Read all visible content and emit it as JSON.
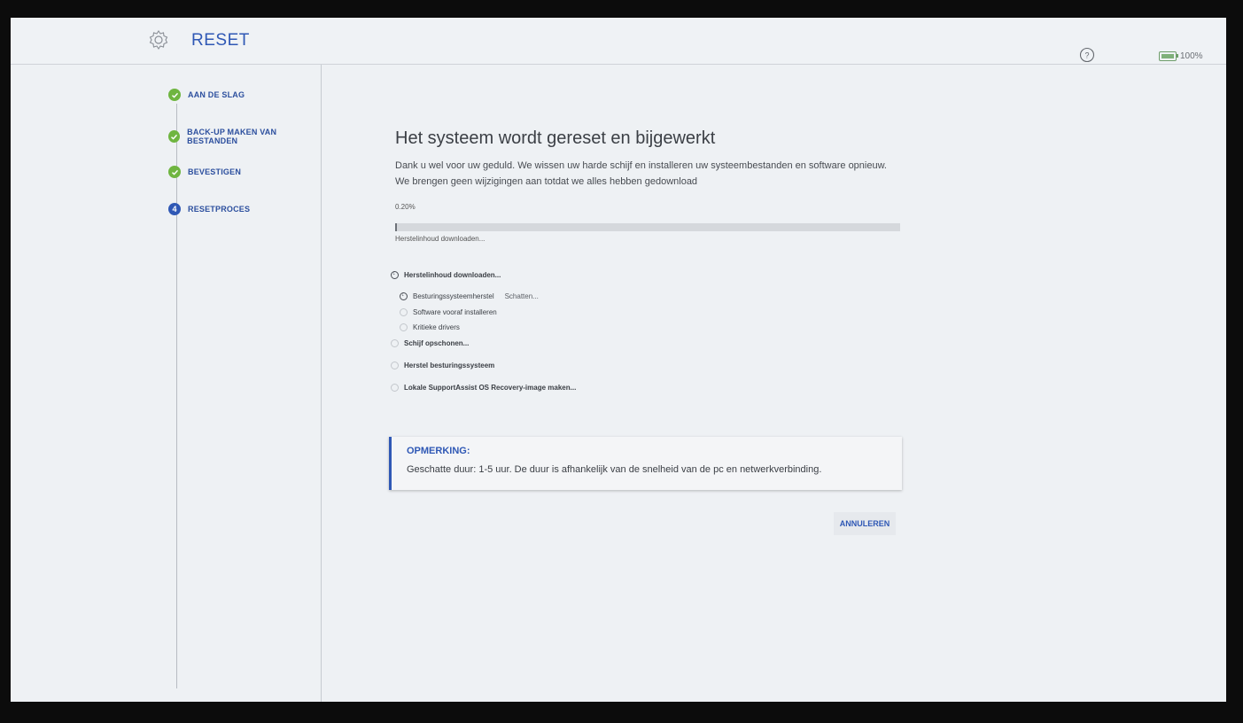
{
  "app": {
    "title": "RESET",
    "icon": "gear-icon"
  },
  "status": {
    "help_icon": "help-icon",
    "battery_level": "100%",
    "battery_color": "#6fb540"
  },
  "steps": [
    {
      "label": "AAN DE SLAG",
      "state": "done"
    },
    {
      "label": "BACK-UP MAKEN VAN BESTANDEN",
      "state": "done"
    },
    {
      "label": "BEVESTIGEN",
      "state": "done"
    },
    {
      "label": "RESETPROCES",
      "state": "active",
      "number": "4"
    }
  ],
  "main": {
    "heading": "Het systeem wordt gereset en bijgewerkt",
    "description_line1": "Dank u wel voor uw geduld. We wissen uw harde schijf en installeren uw systeembestanden en software opnieuw.",
    "description_line2": "We brengen geen wijzigingen aan totdat we alles hebben gedownload",
    "progress": {
      "percent_text": "0.20%",
      "value": 0.002,
      "label": "Herstelinhoud downloaden..."
    },
    "tasks": [
      {
        "label": "Herstelinhoud downloaden...",
        "state": "in-progress",
        "level": 0
      },
      {
        "label": "Besturingssysteemherstel",
        "status": "Schatten...",
        "state": "in-progress",
        "level": 1
      },
      {
        "label": "Software vooraf installeren",
        "state": "pending",
        "level": 1
      },
      {
        "label": "Kritieke drivers",
        "state": "pending",
        "level": 1
      },
      {
        "label": "Schijf opschonen...",
        "state": "pending",
        "level": 0
      },
      {
        "label": "Herstel besturingssysteem",
        "state": "pending",
        "level": 0
      },
      {
        "label": "Lokale SupportAssist OS Recovery-image maken...",
        "state": "pending",
        "level": 0
      }
    ],
    "note": {
      "title": "OPMERKING:",
      "text": "Geschatte duur: 1-5 uur. De duur is afhankelijk van de snelheid van de pc en netwerkverbinding."
    },
    "cancel_label": "ANNULEREN"
  },
  "colors": {
    "accent": "#2f58b5",
    "done": "#6fb540",
    "background": "#eef1f4"
  }
}
